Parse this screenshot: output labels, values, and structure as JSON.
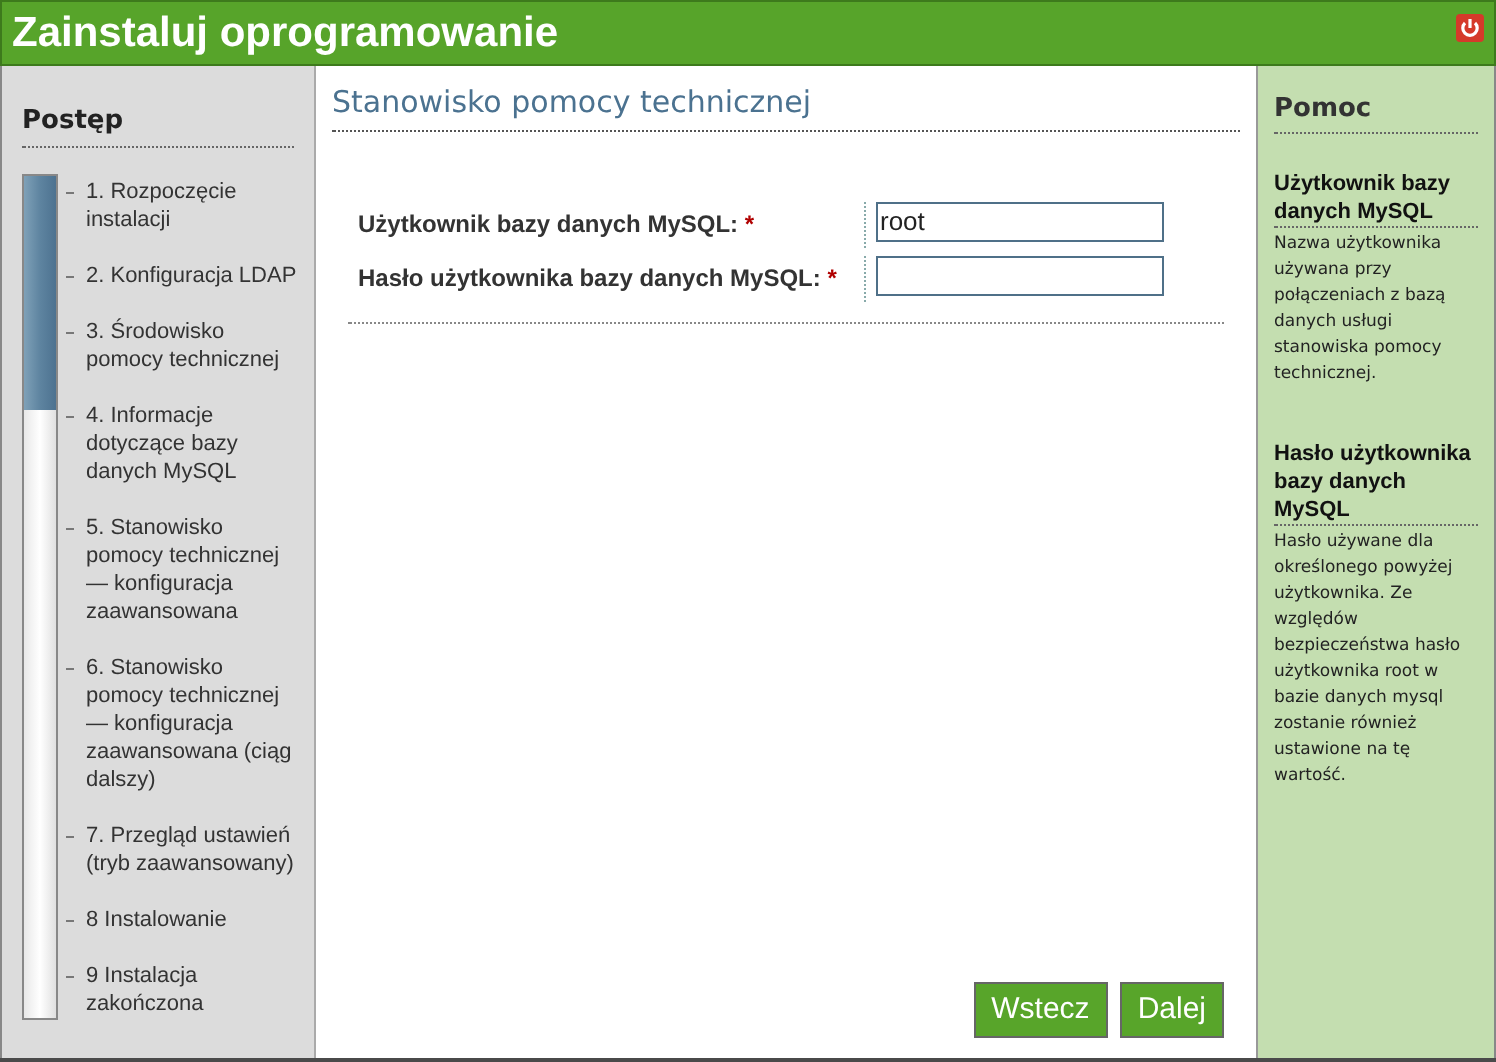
{
  "window": {
    "title": "Zainstaluj oprogramowanie"
  },
  "progress": {
    "title": "Postęp",
    "level": 0.28,
    "steps": [
      {
        "label": "1. Rozpoczęcie instalacji"
      },
      {
        "label": "2. Konfiguracja LDAP"
      },
      {
        "label": "3. Środowisko pomocy technicznej"
      },
      {
        "label": "4. Informacje dotyczące bazy danych MySQL"
      },
      {
        "label": "5. Stanowisko pomocy technicznej — konfiguracja zaawansowana"
      },
      {
        "label": "6. Stanowisko pomocy technicznej — konfiguracja zaawansowana (ciąg dalszy)"
      },
      {
        "label": "7. Przegląd ustawień (tryb zaawansowany)"
      },
      {
        "label": "8 Instalowanie"
      },
      {
        "label": "9 Instalacja zakończona"
      }
    ]
  },
  "main": {
    "title": "Stanowisko pomocy technicznej",
    "fields": [
      {
        "label": "Użytkownik bazy danych MySQL:",
        "required_mark": "*",
        "value": "root"
      },
      {
        "label": "Hasło użytkownika bazy danych MySQL:",
        "required_mark": "*"
      }
    ]
  },
  "buttons": [
    "Wstecz",
    "Dalej"
  ],
  "help": {
    "title": "Pomoc",
    "sections": [
      {
        "heading": "Użytkownik bazy danych MySQL",
        "text": "Nazwa użytkownika używana przy połączeniach z bazą danych usługi stanowiska pomocy technicznej."
      },
      {
        "heading": "Hasło użytkownika bazy danych MySQL",
        "text": "Hasło używane dla określonego powyżej użytkownika. Ze względów bezpieczeństwa hasło użytkownika root w bazie danych mysql zostanie również ustawione na tę wartość."
      }
    ]
  }
}
